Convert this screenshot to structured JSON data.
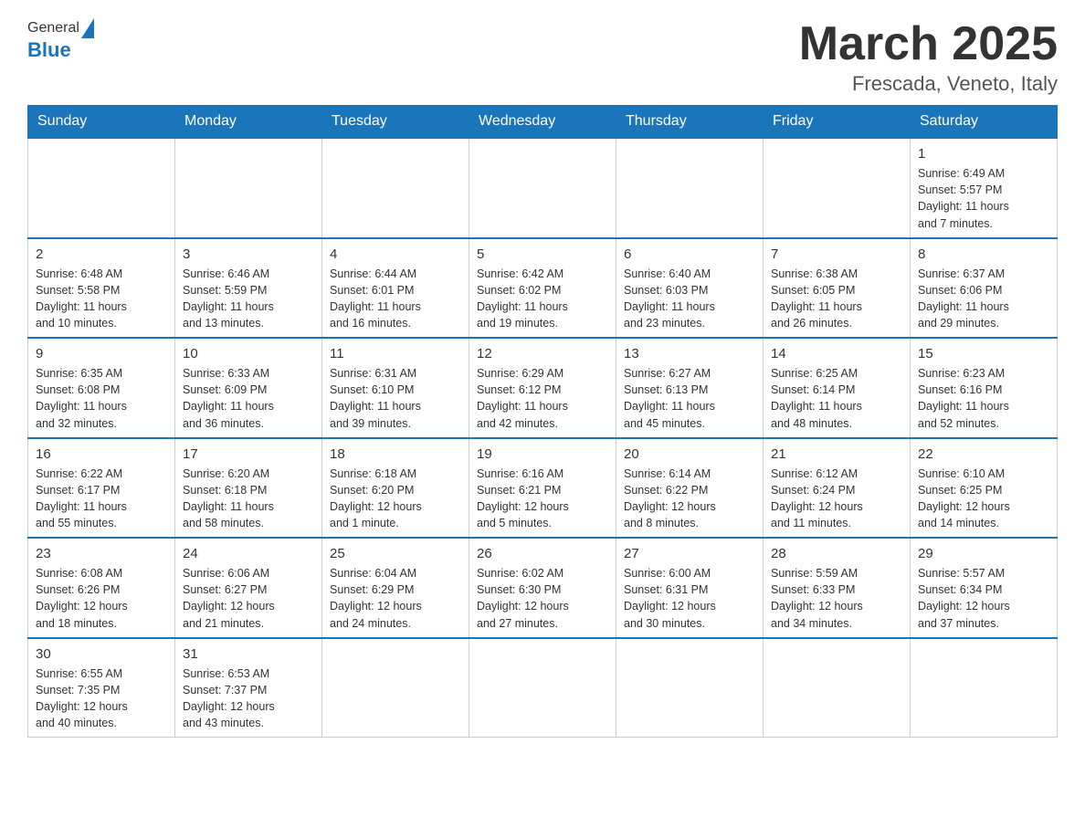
{
  "header": {
    "logo_general": "General",
    "logo_blue": "Blue",
    "month_year": "March 2025",
    "location": "Frescada, Veneto, Italy"
  },
  "days_of_week": [
    "Sunday",
    "Monday",
    "Tuesday",
    "Wednesday",
    "Thursday",
    "Friday",
    "Saturday"
  ],
  "weeks": [
    [
      {
        "day": "",
        "info": ""
      },
      {
        "day": "",
        "info": ""
      },
      {
        "day": "",
        "info": ""
      },
      {
        "day": "",
        "info": ""
      },
      {
        "day": "",
        "info": ""
      },
      {
        "day": "",
        "info": ""
      },
      {
        "day": "1",
        "info": "Sunrise: 6:49 AM\nSunset: 5:57 PM\nDaylight: 11 hours\nand 7 minutes."
      }
    ],
    [
      {
        "day": "2",
        "info": "Sunrise: 6:48 AM\nSunset: 5:58 PM\nDaylight: 11 hours\nand 10 minutes."
      },
      {
        "day": "3",
        "info": "Sunrise: 6:46 AM\nSunset: 5:59 PM\nDaylight: 11 hours\nand 13 minutes."
      },
      {
        "day": "4",
        "info": "Sunrise: 6:44 AM\nSunset: 6:01 PM\nDaylight: 11 hours\nand 16 minutes."
      },
      {
        "day": "5",
        "info": "Sunrise: 6:42 AM\nSunset: 6:02 PM\nDaylight: 11 hours\nand 19 minutes."
      },
      {
        "day": "6",
        "info": "Sunrise: 6:40 AM\nSunset: 6:03 PM\nDaylight: 11 hours\nand 23 minutes."
      },
      {
        "day": "7",
        "info": "Sunrise: 6:38 AM\nSunset: 6:05 PM\nDaylight: 11 hours\nand 26 minutes."
      },
      {
        "day": "8",
        "info": "Sunrise: 6:37 AM\nSunset: 6:06 PM\nDaylight: 11 hours\nand 29 minutes."
      }
    ],
    [
      {
        "day": "9",
        "info": "Sunrise: 6:35 AM\nSunset: 6:08 PM\nDaylight: 11 hours\nand 32 minutes."
      },
      {
        "day": "10",
        "info": "Sunrise: 6:33 AM\nSunset: 6:09 PM\nDaylight: 11 hours\nand 36 minutes."
      },
      {
        "day": "11",
        "info": "Sunrise: 6:31 AM\nSunset: 6:10 PM\nDaylight: 11 hours\nand 39 minutes."
      },
      {
        "day": "12",
        "info": "Sunrise: 6:29 AM\nSunset: 6:12 PM\nDaylight: 11 hours\nand 42 minutes."
      },
      {
        "day": "13",
        "info": "Sunrise: 6:27 AM\nSunset: 6:13 PM\nDaylight: 11 hours\nand 45 minutes."
      },
      {
        "day": "14",
        "info": "Sunrise: 6:25 AM\nSunset: 6:14 PM\nDaylight: 11 hours\nand 48 minutes."
      },
      {
        "day": "15",
        "info": "Sunrise: 6:23 AM\nSunset: 6:16 PM\nDaylight: 11 hours\nand 52 minutes."
      }
    ],
    [
      {
        "day": "16",
        "info": "Sunrise: 6:22 AM\nSunset: 6:17 PM\nDaylight: 11 hours\nand 55 minutes."
      },
      {
        "day": "17",
        "info": "Sunrise: 6:20 AM\nSunset: 6:18 PM\nDaylight: 11 hours\nand 58 minutes."
      },
      {
        "day": "18",
        "info": "Sunrise: 6:18 AM\nSunset: 6:20 PM\nDaylight: 12 hours\nand 1 minute."
      },
      {
        "day": "19",
        "info": "Sunrise: 6:16 AM\nSunset: 6:21 PM\nDaylight: 12 hours\nand 5 minutes."
      },
      {
        "day": "20",
        "info": "Sunrise: 6:14 AM\nSunset: 6:22 PM\nDaylight: 12 hours\nand 8 minutes."
      },
      {
        "day": "21",
        "info": "Sunrise: 6:12 AM\nSunset: 6:24 PM\nDaylight: 12 hours\nand 11 minutes."
      },
      {
        "day": "22",
        "info": "Sunrise: 6:10 AM\nSunset: 6:25 PM\nDaylight: 12 hours\nand 14 minutes."
      }
    ],
    [
      {
        "day": "23",
        "info": "Sunrise: 6:08 AM\nSunset: 6:26 PM\nDaylight: 12 hours\nand 18 minutes."
      },
      {
        "day": "24",
        "info": "Sunrise: 6:06 AM\nSunset: 6:27 PM\nDaylight: 12 hours\nand 21 minutes."
      },
      {
        "day": "25",
        "info": "Sunrise: 6:04 AM\nSunset: 6:29 PM\nDaylight: 12 hours\nand 24 minutes."
      },
      {
        "day": "26",
        "info": "Sunrise: 6:02 AM\nSunset: 6:30 PM\nDaylight: 12 hours\nand 27 minutes."
      },
      {
        "day": "27",
        "info": "Sunrise: 6:00 AM\nSunset: 6:31 PM\nDaylight: 12 hours\nand 30 minutes."
      },
      {
        "day": "28",
        "info": "Sunrise: 5:59 AM\nSunset: 6:33 PM\nDaylight: 12 hours\nand 34 minutes."
      },
      {
        "day": "29",
        "info": "Sunrise: 5:57 AM\nSunset: 6:34 PM\nDaylight: 12 hours\nand 37 minutes."
      }
    ],
    [
      {
        "day": "30",
        "info": "Sunrise: 6:55 AM\nSunset: 7:35 PM\nDaylight: 12 hours\nand 40 minutes."
      },
      {
        "day": "31",
        "info": "Sunrise: 6:53 AM\nSunset: 7:37 PM\nDaylight: 12 hours\nand 43 minutes."
      },
      {
        "day": "",
        "info": ""
      },
      {
        "day": "",
        "info": ""
      },
      {
        "day": "",
        "info": ""
      },
      {
        "day": "",
        "info": ""
      },
      {
        "day": "",
        "info": ""
      }
    ]
  ]
}
